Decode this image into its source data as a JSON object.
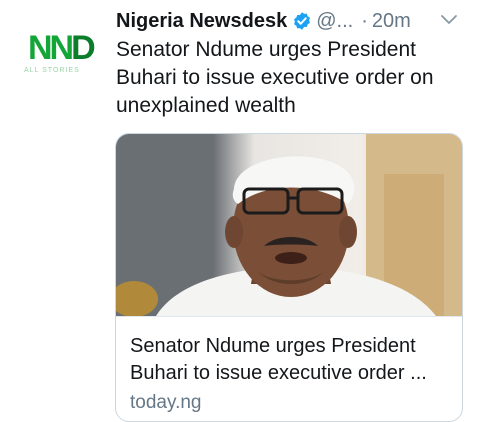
{
  "tweet": {
    "avatar_logo_text": "NND",
    "avatar_sub_text": "ALL STORIES",
    "display_name": "Nigeria Newsdesk",
    "handle": "@...",
    "separator": "·",
    "timestamp": "20m",
    "verified": true,
    "text": "Senator Ndume urges President Buhari to issue executive order on unexplained wealth"
  },
  "card": {
    "title_line1": "Senator Ndume urges President",
    "title_line2": "Buhari to issue executive order ...",
    "domain": "today.ng"
  },
  "colors": {
    "brand_green": "#13a538",
    "verified_blue": "#1da1f2",
    "secondary_text": "#657786",
    "card_border": "#ccd6dd"
  },
  "icons": [
    "verified-badge-icon",
    "chevron-down-icon"
  ]
}
